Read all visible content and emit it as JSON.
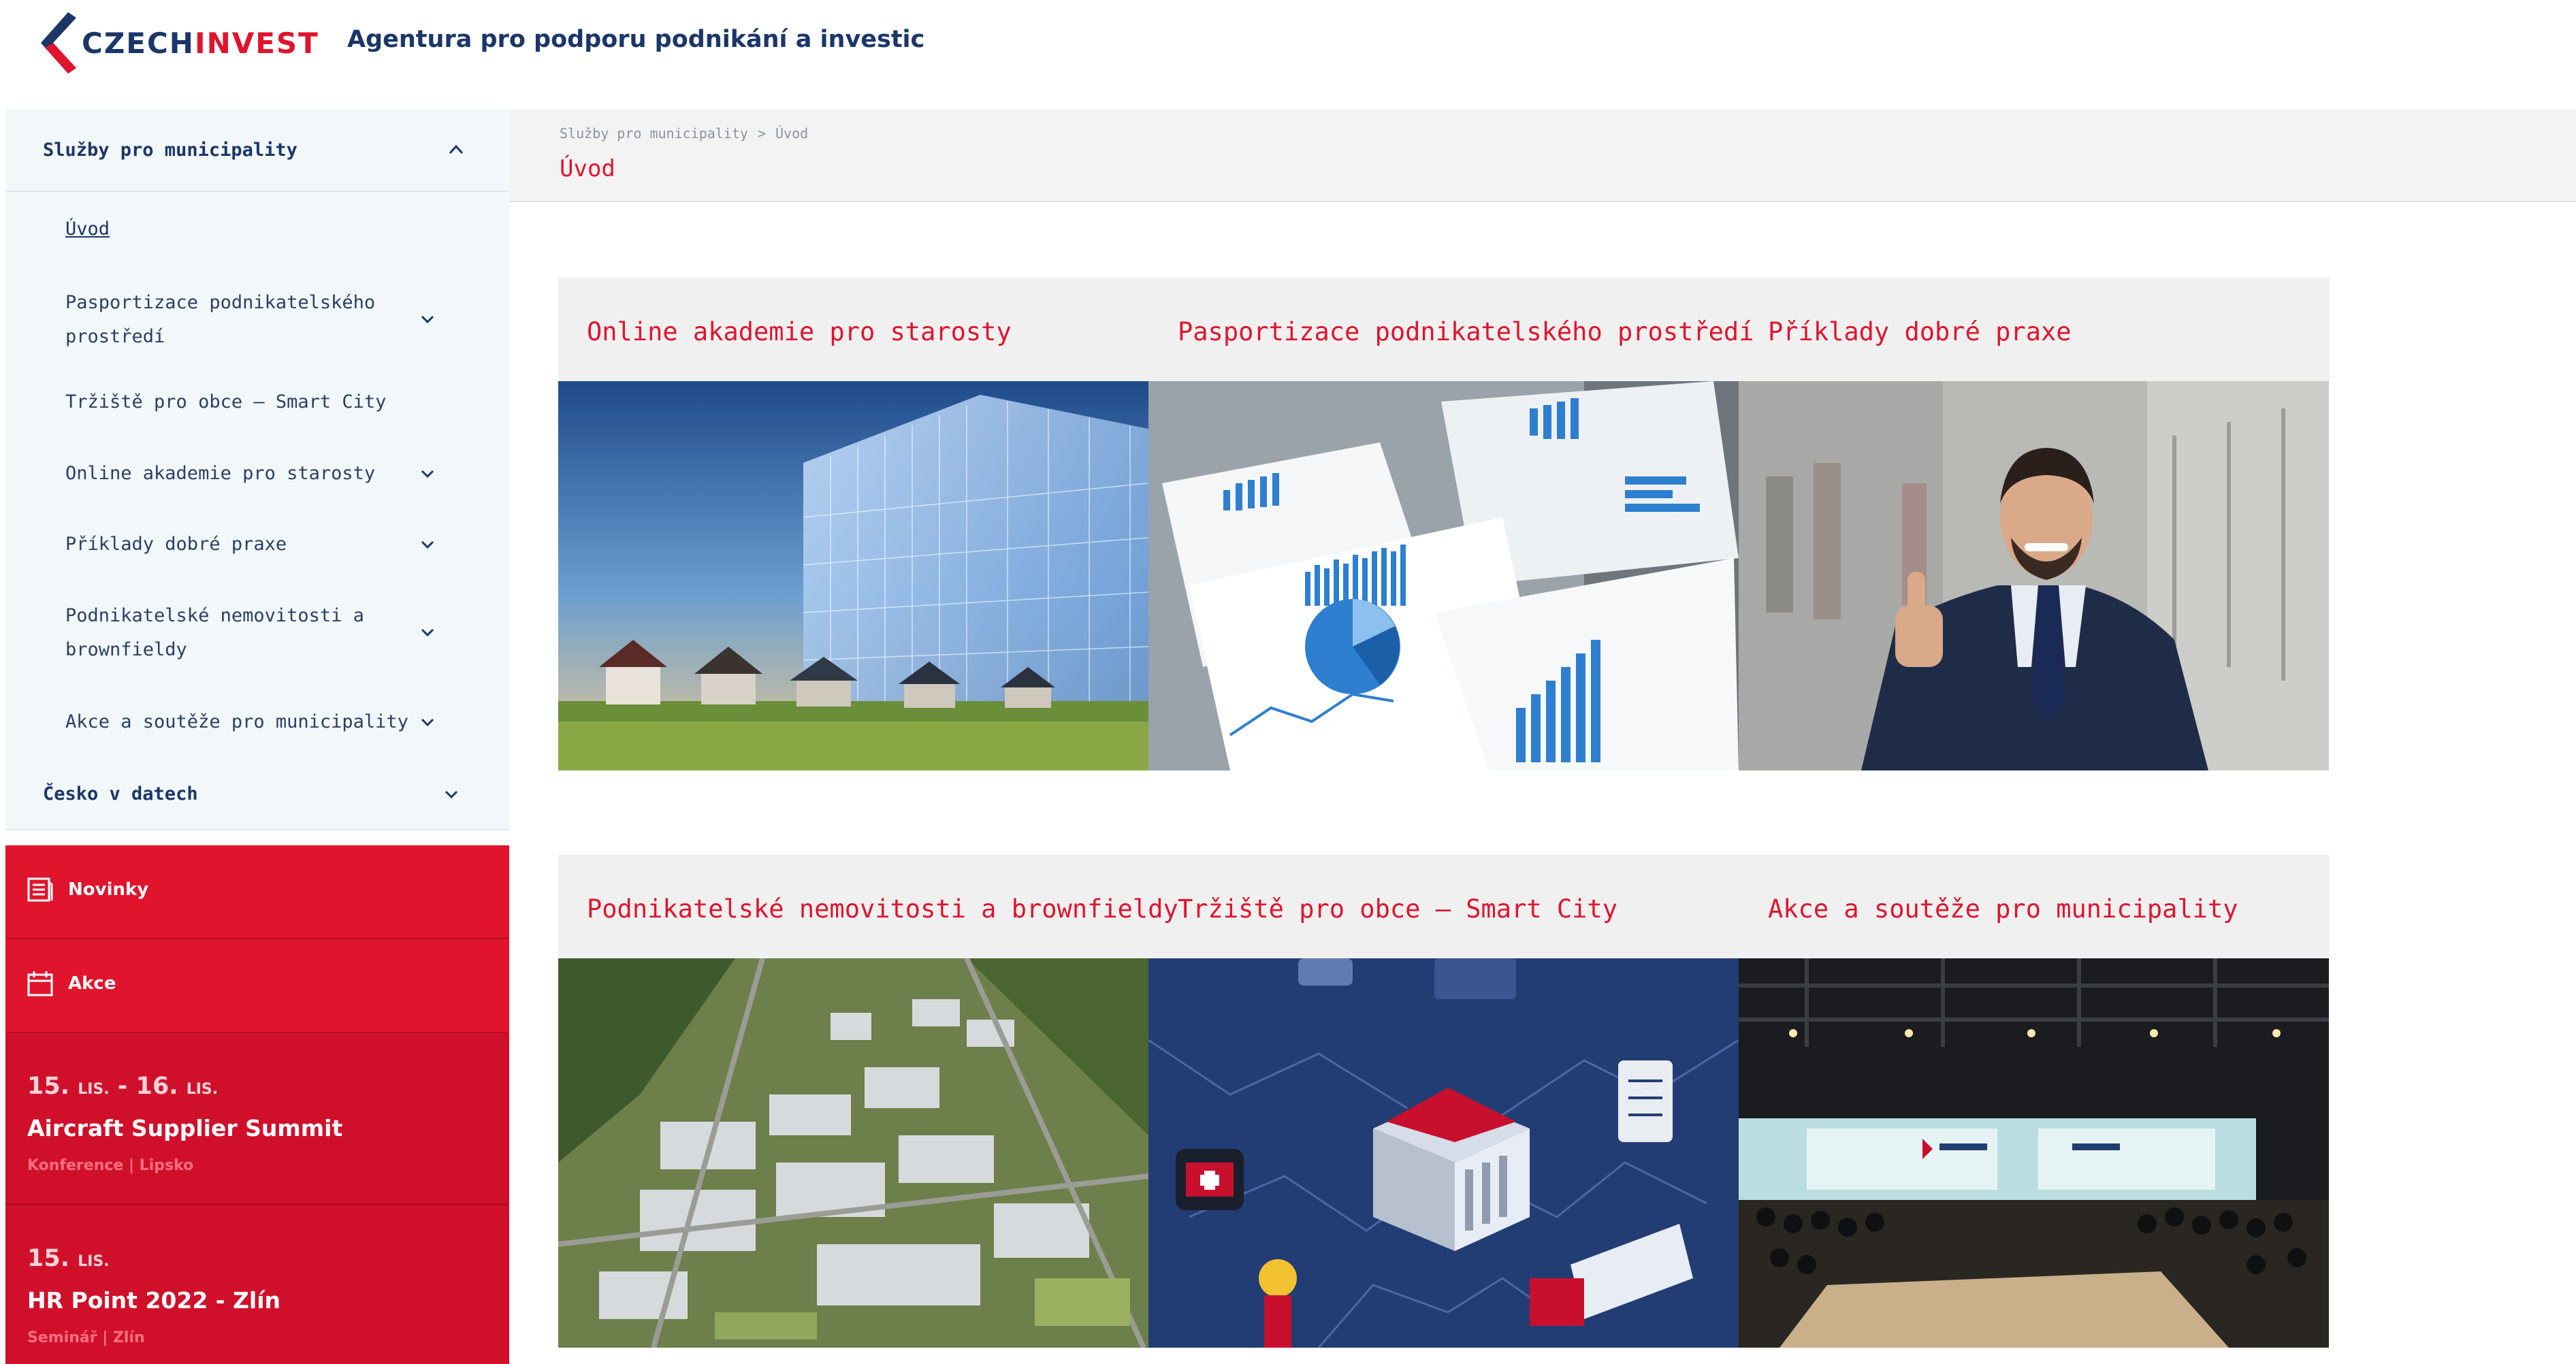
{
  "header": {
    "logo_part1": "CZECH",
    "logo_part2": "INVEST",
    "tagline": "Agentura pro podporu podnikání a investic",
    "brand_blue": "#1b3668",
    "brand_red": "#e0142d"
  },
  "sidebar": {
    "section_title": "Služby pro municipality",
    "items": [
      {
        "label": "Úvod",
        "active": true
      },
      {
        "label": "Pasportizace podnikatelského prostředí",
        "line1": "Pasportizace podnikatelského",
        "line2": "prostředí",
        "expandable": true
      },
      {
        "label": "Tržiště pro obce – Smart City",
        "expandable": false
      },
      {
        "label": "Online akademie pro starosty",
        "expandable": true
      },
      {
        "label": "Příklady dobré praxe",
        "expandable": true
      },
      {
        "label": "Podnikatelské nemovitosti a brownfieldy",
        "line1": "Podnikatelské nemovitosti a",
        "line2": "brownfieldy",
        "expandable": true
      },
      {
        "label": "Akce a soutěže pro municipality",
        "expandable": true
      }
    ],
    "section2_title": "Česko v datech",
    "news_label": "Novinky",
    "events_label": "Akce",
    "events": [
      {
        "date_day1": "15.",
        "date_month1": "LIS.",
        "date_sep": " - ",
        "date_day2": "16.",
        "date_month2": "LIS.",
        "title": "Aircraft Supplier Summit",
        "meta": "Konference | Lipsko"
      },
      {
        "date_day1": "15.",
        "date_month1": "LIS.",
        "title": "HR Point 2022 - Zlín",
        "meta": "Seminář | Zlín"
      }
    ]
  },
  "breadcrumb": {
    "items": [
      "Služby pro municipality",
      "Úvod"
    ],
    "separator": ">",
    "page_title": "Úvod"
  },
  "cards": [
    {
      "title": "Online akademie pro starosty",
      "image": "building-houses-photo"
    },
    {
      "title": "Pasportizace podnikatelského prostředí",
      "image": "charts-papers-photo"
    },
    {
      "title": "Příklady dobré praxe",
      "image": "businessman-thumbs-up-photo"
    },
    {
      "title": "Podnikatelské nemovitosti a brownfieldy",
      "image": "industrial-park-aerial-photo"
    },
    {
      "title": "Tržiště pro obce – Smart City",
      "image": "smart-city-illustration"
    },
    {
      "title": "Akce a soutěže pro municipality",
      "image": "conference-hall-photo"
    }
  ],
  "icons": {
    "collapse": "chevron-up-icon",
    "expand": "chevron-down-icon",
    "news": "newspaper-icon",
    "events": "calendar-icon"
  }
}
